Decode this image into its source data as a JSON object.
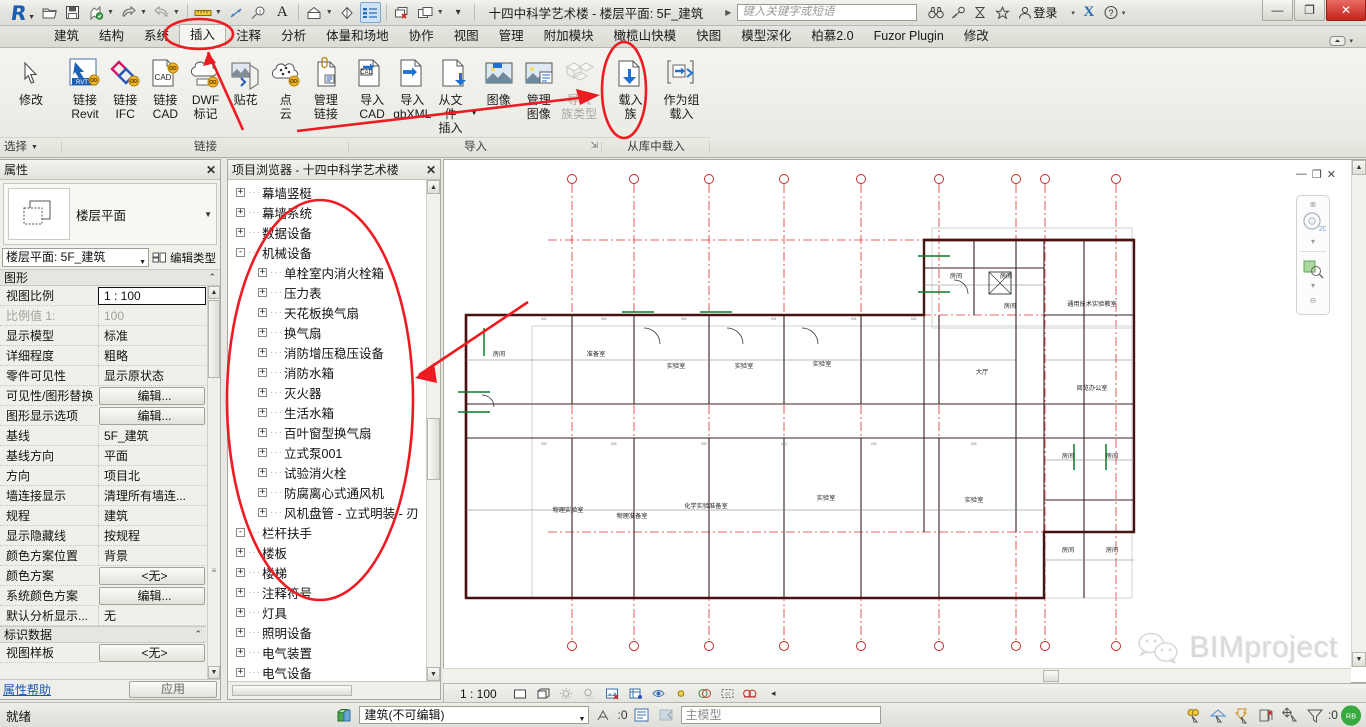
{
  "titlebar": {
    "logo": "revit-logo",
    "quick_access": [
      {
        "name": "open-file",
        "icon": "folder-open-icon"
      },
      {
        "name": "save",
        "icon": "floppy-disk-icon"
      },
      {
        "name": "sync-with-central",
        "icon": "sync-icon"
      },
      {
        "name": "undo",
        "icon": "undo-arrow-icon"
      },
      {
        "name": "redo",
        "icon": "redo-arrow-icon"
      },
      {
        "name": "measure",
        "icon": "ruler-icon"
      },
      {
        "name": "aligned-dimension",
        "icon": "dimension-icon"
      },
      {
        "name": "tag",
        "icon": "tag-icon"
      },
      {
        "name": "text",
        "icon": "text-a-icon"
      },
      {
        "name": "default-3d-view",
        "icon": "house-3d-icon"
      },
      {
        "name": "section",
        "icon": "section-icon"
      },
      {
        "name": "thin-lines",
        "icon": "thin-lines-icon"
      },
      {
        "name": "close-hidden-windows",
        "icon": "close-window-icon"
      },
      {
        "name": "switch-windows",
        "icon": "switch-window-icon"
      },
      {
        "name": "customize-qat",
        "icon": "overflow-caret-icon"
      }
    ],
    "document_title": "十四中科学艺术楼 - 楼层平面: 5F_建筑",
    "search_placeholder": "键入关键字或短语",
    "right_icons": [
      {
        "name": "search-help",
        "icon": "binoculars-icon"
      },
      {
        "name": "subscription",
        "icon": "key-icon"
      },
      {
        "name": "communication-center",
        "icon": "hourglass-icon"
      },
      {
        "name": "favorites",
        "icon": "star-icon"
      }
    ],
    "sign_in": "登录",
    "exchange": "X",
    "help": "?",
    "window_buttons": {
      "minimize": "—",
      "restore": "❐",
      "close": "✕"
    }
  },
  "tabs": {
    "items": [
      {
        "label": "建筑",
        "selected": false
      },
      {
        "label": "结构",
        "selected": false
      },
      {
        "label": "系统",
        "selected": false
      },
      {
        "label": "插入",
        "selected": true
      },
      {
        "label": "注释",
        "selected": false
      },
      {
        "label": "分析",
        "selected": false
      },
      {
        "label": "体量和场地",
        "selected": false
      },
      {
        "label": "协作",
        "selected": false
      },
      {
        "label": "视图",
        "selected": false
      },
      {
        "label": "管理",
        "selected": false
      },
      {
        "label": "附加模块",
        "selected": false
      },
      {
        "label": "橄榄山快模",
        "selected": false
      },
      {
        "label": "快图",
        "selected": false
      },
      {
        "label": "模型深化",
        "selected": false
      },
      {
        "label": "柏慕2.0",
        "selected": false
      },
      {
        "label": "Fuzor Plugin",
        "selected": false
      },
      {
        "label": "修改",
        "selected": false
      }
    ]
  },
  "ribbon": {
    "select_panel": {
      "label": "选择",
      "button": {
        "label": "修改",
        "icon": "cursor-arrow-icon"
      }
    },
    "link_panel": {
      "label": "链接",
      "buttons": [
        {
          "label1": "链接",
          "label2": "Revit",
          "icon": "link-revit-icon",
          "name": "link-revit"
        },
        {
          "label1": "链接",
          "label2": "IFC",
          "icon": "link-ifc-icon",
          "name": "link-ifc"
        },
        {
          "label1": "链接",
          "label2": "CAD",
          "icon": "link-cad-icon",
          "name": "link-cad"
        },
        {
          "label1": "DWF",
          "label2": "标记",
          "icon": "dwf-markup-icon",
          "name": "dwf-markup"
        },
        {
          "label1": "贴花",
          "label2": "",
          "icon": "decal-icon",
          "name": "decal"
        },
        {
          "label1": "点",
          "label2": "云",
          "icon": "point-cloud-icon",
          "name": "point-cloud"
        },
        {
          "label1": "管理",
          "label2": "链接",
          "icon": "manage-links-icon",
          "name": "manage-links"
        }
      ]
    },
    "import_panel": {
      "label": "导入",
      "buttons": [
        {
          "label1": "导入",
          "label2": "CAD",
          "icon": "import-cad-icon",
          "name": "import-cad",
          "disabled": false
        },
        {
          "label1": "导入",
          "label2": "gbXML",
          "icon": "import-gbxml-icon",
          "name": "import-gbxml",
          "disabled": false
        },
        {
          "label1": "从文件",
          "label2": "插入",
          "icon": "insert-from-file-icon",
          "name": "insert-from-file",
          "disabled": false
        },
        {
          "label1": "图像",
          "label2": "",
          "icon": "image-icon",
          "name": "image",
          "disabled": false
        },
        {
          "label1": "管理",
          "label2": "图像",
          "icon": "manage-images-icon",
          "name": "manage-images",
          "disabled": false
        },
        {
          "label1": "导入",
          "label2": "族类型",
          "icon": "import-family-types-icon",
          "name": "import-family-types",
          "disabled": true
        }
      ],
      "expander": "⇲"
    },
    "library_panel": {
      "label": "从库中载入",
      "buttons": [
        {
          "label1": "载入",
          "label2": "族",
          "icon": "load-family-icon",
          "name": "load-family"
        },
        {
          "label1": "作为组",
          "label2": "载入",
          "icon": "load-as-group-icon",
          "name": "load-as-group"
        }
      ]
    }
  },
  "properties": {
    "header": "属性",
    "close": "✕",
    "type_preview_name": "楼层平面",
    "type_selector": "楼层平面: 5F_建筑",
    "edit_type": "编辑类型",
    "groups": [
      {
        "name": "图形",
        "collapse": "⌃"
      },
      {
        "name": "标识数据",
        "collapse": "⌃"
      }
    ],
    "rows": [
      {
        "key": "视图比例",
        "value": "1 : 100",
        "style": "boxed"
      },
      {
        "key": "比例值 1:",
        "value": "100",
        "style": "dim"
      },
      {
        "key": "显示模型",
        "value": "标准",
        "style": "text"
      },
      {
        "key": "详细程度",
        "value": "粗略",
        "style": "text"
      },
      {
        "key": "零件可见性",
        "value": "显示原状态",
        "style": "text"
      },
      {
        "key": "可见性/图形替换",
        "value": "编辑...",
        "style": "button"
      },
      {
        "key": "图形显示选项",
        "value": "编辑...",
        "style": "button"
      },
      {
        "key": "基线",
        "value": "5F_建筑",
        "style": "text"
      },
      {
        "key": "基线方向",
        "value": "平面",
        "style": "text"
      },
      {
        "key": "方向",
        "value": "项目北",
        "style": "text"
      },
      {
        "key": "墙连接显示",
        "value": "清理所有墙连...",
        "style": "text"
      },
      {
        "key": "规程",
        "value": "建筑",
        "style": "text"
      },
      {
        "key": "显示隐藏线",
        "value": "按规程",
        "style": "text"
      },
      {
        "key": "颜色方案位置",
        "value": "背景",
        "style": "text"
      },
      {
        "key": "颜色方案",
        "value": "<无>",
        "style": "button"
      },
      {
        "key": "系统颜色方案",
        "value": "编辑...",
        "style": "button"
      },
      {
        "key": "默认分析显示...",
        "value": "无",
        "style": "text"
      }
    ],
    "rows2": [
      {
        "key": "视图样板",
        "value": "<无>",
        "style": "button"
      }
    ],
    "footer": {
      "help": "属性帮助",
      "apply": "应用"
    }
  },
  "browser": {
    "header": "项目浏览器 - 十四中科学艺术楼",
    "close": "✕",
    "nodes": [
      {
        "label": "幕墙竖梃",
        "indent": 0,
        "expand": "+"
      },
      {
        "label": "幕墙系统",
        "indent": 0,
        "expand": "+"
      },
      {
        "label": "数据设备",
        "indent": 0,
        "expand": "+"
      },
      {
        "label": "机械设备",
        "indent": 0,
        "expand": "-"
      },
      {
        "label": "单栓室内消火栓箱",
        "indent": 1,
        "expand": "+"
      },
      {
        "label": "压力表",
        "indent": 1,
        "expand": "+"
      },
      {
        "label": "天花板换气扇",
        "indent": 1,
        "expand": "+"
      },
      {
        "label": "换气扇",
        "indent": 1,
        "expand": "+"
      },
      {
        "label": "消防增压稳压设备",
        "indent": 1,
        "expand": "+"
      },
      {
        "label": "消防水箱",
        "indent": 1,
        "expand": "+"
      },
      {
        "label": "灭火器",
        "indent": 1,
        "expand": "+"
      },
      {
        "label": "生活水箱",
        "indent": 1,
        "expand": "+"
      },
      {
        "label": "百叶窗型换气扇",
        "indent": 1,
        "expand": "+"
      },
      {
        "label": "立式泵001",
        "indent": 1,
        "expand": "+"
      },
      {
        "label": "试验消火栓",
        "indent": 1,
        "expand": "+"
      },
      {
        "label": "防腐离心式通风机",
        "indent": 1,
        "expand": "+"
      },
      {
        "label": "风机盘管 - 立式明装 - 刃",
        "indent": 1,
        "expand": "+"
      },
      {
        "label": "栏杆扶手",
        "indent": 0,
        "expand": "-"
      },
      {
        "label": "楼板",
        "indent": 0,
        "expand": "+"
      },
      {
        "label": "楼梯",
        "indent": 0,
        "expand": "+"
      },
      {
        "label": "注释符号",
        "indent": 0,
        "expand": "+"
      },
      {
        "label": "灯具",
        "indent": 0,
        "expand": "+"
      },
      {
        "label": "照明设备",
        "indent": 0,
        "expand": "+"
      },
      {
        "label": "电气装置",
        "indent": 0,
        "expand": "+"
      },
      {
        "label": "电气设备",
        "indent": 0,
        "expand": "+"
      }
    ]
  },
  "canvas": {
    "window_controls": [
      "—",
      "❐",
      "✕"
    ],
    "navigation_bar": {
      "steering_wheel": "2D",
      "zoom": "zoom-icon"
    },
    "watermark": "BIMproject",
    "rooms": [
      "准备室",
      "实验室",
      "实验室",
      "实验室",
      "办公",
      "大厅",
      "通用技术实验教室",
      "阅览办公室",
      "物理实验室",
      "物理准备室",
      "化学实验准备室",
      "实验室",
      "实验室"
    ]
  },
  "viewbar": {
    "scale": "1 : 100",
    "icons": [
      {
        "name": "detail-level-coarse-icon"
      },
      {
        "name": "visual-style-icon"
      },
      {
        "name": "sun-path-icon"
      },
      {
        "name": "shadows-icon"
      },
      {
        "name": "render-dialog-icon"
      },
      {
        "name": "crop-view-icon"
      },
      {
        "name": "show-crop-region-icon"
      },
      {
        "name": "temporary-hide-isolate-icon"
      },
      {
        "name": "reveal-hidden-elements-icon"
      },
      {
        "name": "worksharing-display-icon"
      },
      {
        "name": "temporary-view-properties-icon"
      },
      {
        "name": "analytical-model-icon"
      },
      {
        "name": "expand-toolbar-icon"
      }
    ]
  },
  "statusbar": {
    "ready": "就绪",
    "workset": "建筑(不可编辑)",
    "editable_count": ":0",
    "model": "主模型",
    "filter_count": ":0",
    "icons": [
      {
        "name": "worksets-icon"
      },
      {
        "name": "design-options-icon"
      },
      {
        "name": "exclude-options-icon"
      },
      {
        "name": "select-links-icon"
      },
      {
        "name": "select-underlay-icon"
      },
      {
        "name": "select-pinned-icon"
      },
      {
        "name": "select-by-face-icon"
      },
      {
        "name": "drag-elements-icon"
      },
      {
        "name": "filter-icon"
      }
    ]
  }
}
